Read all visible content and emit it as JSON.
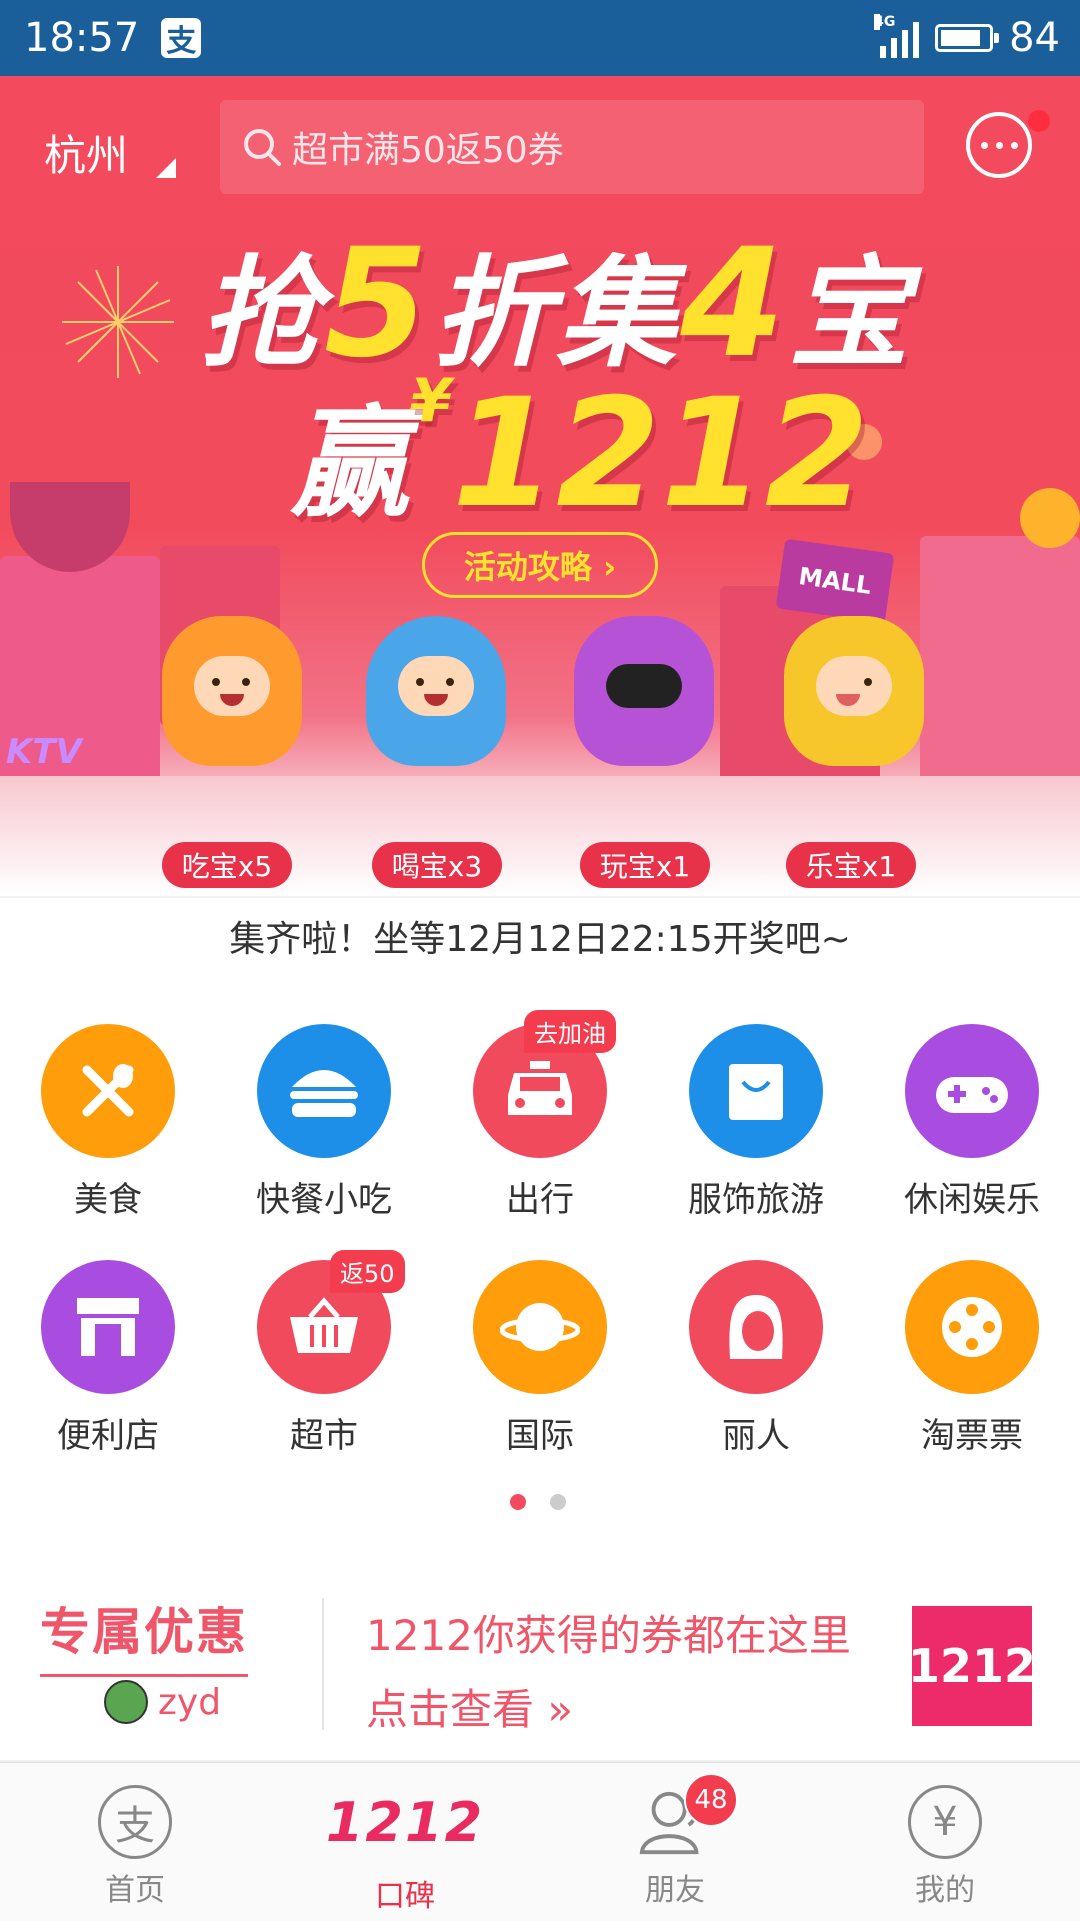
{
  "status_bar": {
    "time": "18:57",
    "alipay_glyph": "支",
    "network": "4G",
    "battery": "84",
    "battery_level": 0.84
  },
  "header": {
    "city": "杭州",
    "search_placeholder": "超市满50返50券"
  },
  "banner": {
    "line1_a": "抢",
    "line1_b": "5",
    "line1_c": "折集",
    "line1_d": "4",
    "line1_e": "宝",
    "line2_a": "赢",
    "line2_yen": "¥",
    "line2_b": "1212",
    "guide_button": "活动攻略 ›",
    "mall_sign": "MALL",
    "ktv_sign": "KTV",
    "badges": [
      "吃宝x5",
      "喝宝x3",
      "玩宝x1",
      "乐宝x1"
    ]
  },
  "result_text": "集齐啦！坐等12月12日22:15开奖吧~",
  "categories": [
    {
      "label": "美食",
      "color": "#ff9d0a"
    },
    {
      "label": "快餐小吃",
      "color": "#1e8fe8"
    },
    {
      "label": "出行",
      "color": "#f24a5d",
      "tag": "去加油"
    },
    {
      "label": "服饰旅游",
      "color": "#1e8fe8"
    },
    {
      "label": "休闲娱乐",
      "color": "#a94de0"
    },
    {
      "label": "便利店",
      "color": "#a94de0"
    },
    {
      "label": "超市",
      "color": "#f24a5d",
      "tag": "返50"
    },
    {
      "label": "国际",
      "color": "#ff9d0a"
    },
    {
      "label": "丽人",
      "color": "#f24a5d"
    },
    {
      "label": "淘票票",
      "color": "#ff9d0a"
    }
  ],
  "pager": {
    "pages": 2,
    "current": 1
  },
  "coupon": {
    "title": "专属优惠",
    "user": "zyd",
    "line1": "1212你获得的券都在这里",
    "line2": "点击查看 »",
    "logo": "1212"
  },
  "tabbar": {
    "tabs": [
      {
        "label": "首页",
        "icon_glyph": "支"
      },
      {
        "label": "口碑",
        "logo": "1212"
      },
      {
        "label": "朋友",
        "badge": "48"
      },
      {
        "label": "我的",
        "icon_glyph": "¥"
      }
    ]
  },
  "colors": {
    "brand_red": "#f34a5e",
    "status_blue": "#1a5f9a",
    "accent_yellow": "#ffe12e"
  }
}
